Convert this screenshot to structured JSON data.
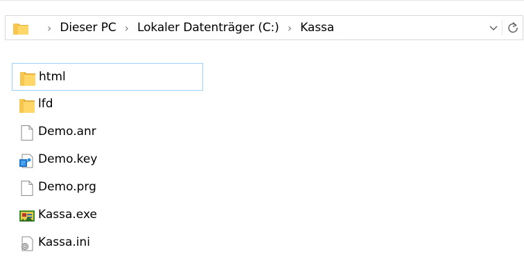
{
  "address_bar": {
    "breadcrumbs": [
      "Dieser PC",
      "Lokaler Datenträger (C:)",
      "Kassa"
    ],
    "separator": "›",
    "icons": [
      "folder-icon",
      "chevron-right-icon",
      "chevron-down-icon",
      "refresh-icon"
    ]
  },
  "files": [
    {
      "name": "html",
      "icon": "folder-icon",
      "selected": true
    },
    {
      "name": "lfd",
      "icon": "folder-icon",
      "selected": false
    },
    {
      "name": "Demo.anr",
      "icon": "file-icon",
      "selected": false
    },
    {
      "name": "Demo.key",
      "icon": "key-file-icon",
      "selected": false
    },
    {
      "name": "Demo.prg",
      "icon": "file-icon",
      "selected": false
    },
    {
      "name": "Kassa.exe",
      "icon": "exe-icon",
      "selected": false
    },
    {
      "name": "Kassa.ini",
      "icon": "settings-file-icon",
      "selected": false
    }
  ],
  "colors": {
    "selection_border": "#99d1ff",
    "folder": "#ffd768",
    "folder_dark": "#e8b13c"
  }
}
